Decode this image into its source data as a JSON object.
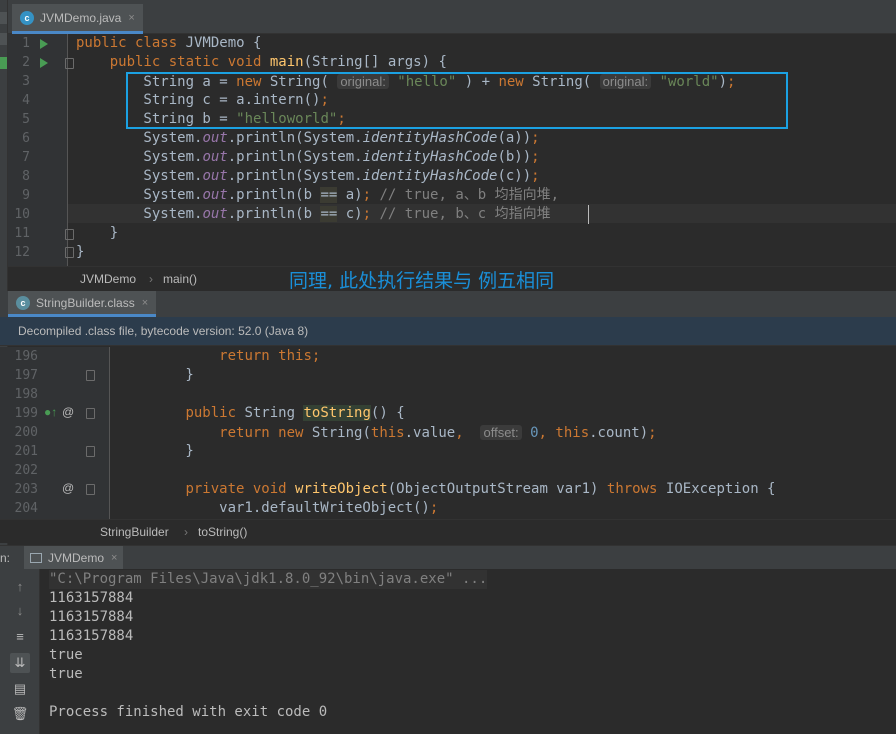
{
  "tabs_top": [
    {
      "label": "JVMDemo.java",
      "close": "×"
    }
  ],
  "editor1": {
    "lines": [
      {
        "n": "1",
        "parts": [
          [
            "kw",
            "public class "
          ],
          [
            "",
            "JVMDemo {"
          ]
        ]
      },
      {
        "n": "2",
        "parts": [
          [
            "",
            "    "
          ],
          [
            "kw",
            "public static void "
          ],
          [
            "fn",
            "main"
          ],
          [
            "",
            "(String[] args) {"
          ]
        ]
      },
      {
        "n": "3",
        "parts": [
          [
            "",
            "        String a = "
          ],
          [
            "kw",
            "new "
          ],
          [
            "",
            "String( "
          ],
          [
            "hint",
            "original:"
          ],
          [
            "",
            " "
          ],
          [
            "st",
            "\"hello\""
          ],
          [
            "",
            " ) + "
          ],
          [
            "kw",
            "new "
          ],
          [
            "",
            "String( "
          ],
          [
            "hint",
            "original:"
          ],
          [
            "",
            " "
          ],
          [
            "st",
            "\"world\""
          ],
          [
            "",
            ")"
          ],
          [
            "kw",
            ";"
          ]
        ]
      },
      {
        "n": "4",
        "parts": [
          [
            "",
            "        String c = a.intern()"
          ],
          [
            "kw",
            ";"
          ]
        ]
      },
      {
        "n": "5",
        "parts": [
          [
            "",
            "        String b = "
          ],
          [
            "st",
            "\"helloworld\""
          ],
          [
            "kw",
            ";"
          ]
        ]
      },
      {
        "n": "6",
        "parts": [
          [
            "",
            "        System."
          ],
          [
            "it",
            "out"
          ],
          [
            "",
            ".println(System."
          ],
          [
            "sm",
            "identityHashCode"
          ],
          [
            "",
            "(a))"
          ],
          [
            "kw",
            ";"
          ]
        ]
      },
      {
        "n": "7",
        "parts": [
          [
            "",
            "        System."
          ],
          [
            "it",
            "out"
          ],
          [
            "",
            ".println(System."
          ],
          [
            "sm",
            "identityHashCode"
          ],
          [
            "",
            "(b))"
          ],
          [
            "kw",
            ";"
          ]
        ]
      },
      {
        "n": "8",
        "parts": [
          [
            "",
            "        System."
          ],
          [
            "it",
            "out"
          ],
          [
            "",
            ".println(System."
          ],
          [
            "sm",
            "identityHashCode"
          ],
          [
            "",
            "(c))"
          ],
          [
            "kw",
            ";"
          ]
        ]
      },
      {
        "n": "9",
        "parts": [
          [
            "",
            "        System."
          ],
          [
            "it",
            "out"
          ],
          [
            "",
            ".println(b "
          ],
          [
            "hl",
            "=="
          ],
          [
            "",
            " a)"
          ],
          [
            "kw",
            ";"
          ],
          [
            "cm",
            " // true, a、b 均指向堆,"
          ]
        ]
      },
      {
        "n": "10",
        "parts": [
          [
            "",
            "        System."
          ],
          [
            "it",
            "out"
          ],
          [
            "",
            ".println(b "
          ],
          [
            "hl",
            "=="
          ],
          [
            "",
            " c)"
          ],
          [
            "kw",
            ";"
          ],
          [
            "cm",
            " // true, b、c 均指向堆"
          ]
        ]
      },
      {
        "n": "11",
        "parts": [
          [
            "",
            "    }"
          ]
        ]
      },
      {
        "n": "12",
        "parts": [
          [
            "",
            "}"
          ]
        ]
      }
    ]
  },
  "breadcrumb1": [
    "JVMDemo",
    "main()"
  ],
  "annotation": "同理, 此处执行结果与 例五相同",
  "tabs_second": [
    {
      "label": "StringBuilder.class",
      "close": "×"
    }
  ],
  "banner": "Decompiled .class file, bytecode version: 52.0 (Java 8)",
  "editor2": {
    "lines": [
      {
        "n": "196",
        "parts": [
          [
            "",
            "            "
          ],
          [
            "kw",
            "return this;"
          ]
        ]
      },
      {
        "n": "197",
        "parts": [
          [
            "",
            "        }"
          ]
        ]
      },
      {
        "n": "198",
        "parts": [
          [
            "",
            ""
          ]
        ]
      },
      {
        "n": "199",
        "parts": [
          [
            "",
            "        "
          ],
          [
            "kw",
            "public "
          ],
          [
            "",
            "String "
          ],
          [
            "hlfn",
            "toString"
          ],
          [
            "",
            "() {"
          ]
        ]
      },
      {
        "n": "200",
        "parts": [
          [
            "",
            "            "
          ],
          [
            "kw",
            "return new "
          ],
          [
            "",
            "String("
          ],
          [
            "kw",
            "this"
          ],
          [
            "",
            ".value"
          ],
          [
            "kw",
            ", "
          ],
          [
            "",
            " "
          ],
          [
            "hint",
            "offset:"
          ],
          [
            "",
            " "
          ],
          [
            "num",
            "0"
          ],
          [
            "kw",
            ", "
          ],
          [
            "kw",
            "this"
          ],
          [
            "",
            ".count)"
          ],
          [
            "kw",
            ";"
          ]
        ]
      },
      {
        "n": "201",
        "parts": [
          [
            "",
            "        }"
          ]
        ]
      },
      {
        "n": "202",
        "parts": [
          [
            "",
            ""
          ]
        ]
      },
      {
        "n": "203",
        "parts": [
          [
            "",
            "        "
          ],
          [
            "kw",
            "private void "
          ],
          [
            "fn",
            "writeObject"
          ],
          [
            "",
            "(ObjectOutputStream var1) "
          ],
          [
            "kw",
            "throws "
          ],
          [
            "",
            "IOException {"
          ]
        ]
      },
      {
        "n": "204",
        "parts": [
          [
            "",
            "            var1.defaultWriteObject()"
          ],
          [
            "kw",
            ";"
          ]
        ]
      }
    ]
  },
  "breadcrumb2": [
    "StringBuilder",
    "toString()"
  ],
  "run": {
    "prefix": "n:",
    "tab_label": "JVMDemo",
    "close": "×",
    "console_lines": [
      "\"C:\\Program Files\\Java\\jdk1.8.0_92\\bin\\java.exe\" ...",
      "1163157884",
      "1163157884",
      "1163157884",
      "true",
      "true",
      "",
      "Process finished with exit code 0"
    ]
  },
  "colors": {
    "accent": "#1ba1e2",
    "keyword": "#cc7832",
    "string": "#6a8759",
    "method": "#ffc66d"
  }
}
